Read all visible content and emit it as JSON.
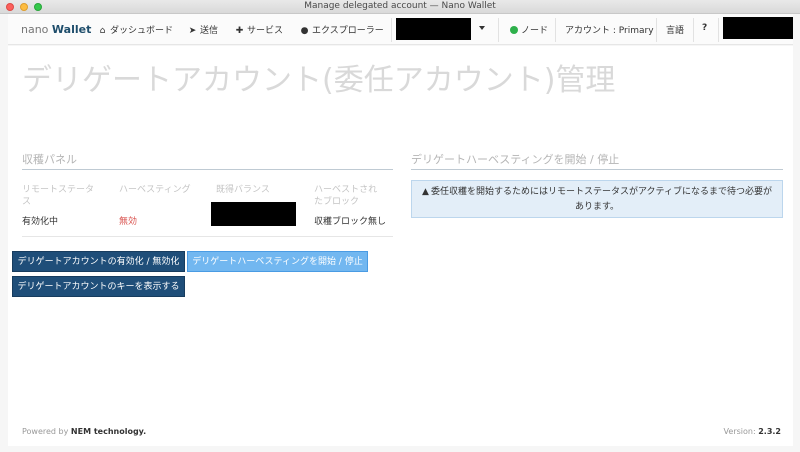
{
  "window": {
    "title": "Manage delegated account — Nano Wallet"
  },
  "navbar": {
    "brand_light": "nano",
    "brand_bold": "Wallet",
    "dashboard": "ダッシュボード",
    "send": "送信",
    "services": "サービス",
    "explorer": "エクスプローラー",
    "node": "ノード",
    "account": "アカウント : Primary",
    "language": "言語",
    "help": "?"
  },
  "page": {
    "title": "デリゲートアカウント(委任アカウント)管理"
  },
  "harvest_panel": {
    "heading": "収穫パネル",
    "col_remote_status": "リモートステータス",
    "col_harvesting": "ハーベスティング",
    "col_balance": "既得バランス",
    "col_harvested_blocks": "ハーベストされたブロック",
    "remote_status": "有効化中",
    "harvesting": "無効",
    "harvested_blocks": "収穫ブロック無し"
  },
  "buttons": {
    "toggle_delegated": "デリゲートアカウントの有効化 / 無効化",
    "start_stop_harvest": "デリゲートハーベスティングを開始 / 停止",
    "show_key": "デリゲートアカウントのキーを表示する"
  },
  "right_panel": {
    "heading": "デリゲートハーベスティングを開始 / 停止",
    "alert": "委任収穫を開始するためにはリモートステータスがアクティブになるまで待つ必要があります。"
  },
  "footer": {
    "powered_prefix": "Powered by",
    "powered_by": "NEM technology.",
    "version_label": "Version:",
    "version": "2.3.2"
  },
  "colors": {
    "primary_button": "#1f4e79",
    "active_button": "#72b7f0",
    "disabled_text": "#d9534f",
    "node_status": "#2eb04b"
  }
}
